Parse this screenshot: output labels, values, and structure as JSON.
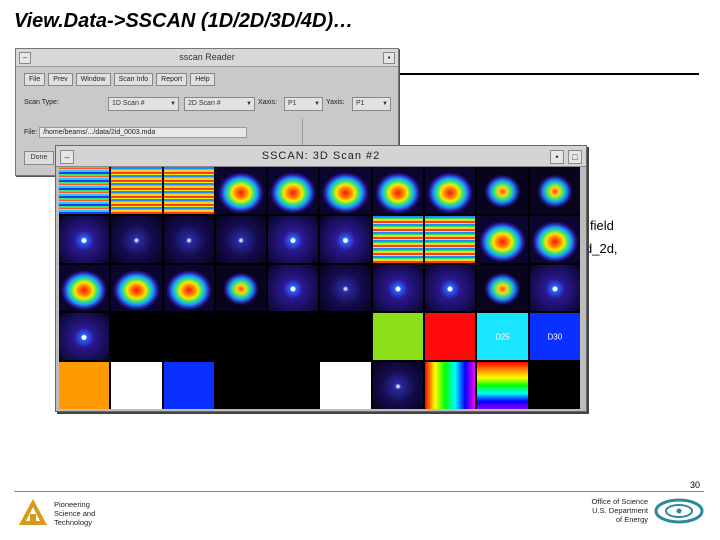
{
  "slide": {
    "title": "View.Data->SSCAN (1D/2D/3D/4D)…",
    "bg_text_1": "field",
    "bg_text_2": "d_2d,",
    "page_number": "30"
  },
  "reader_window": {
    "title": "sscan Reader",
    "menu": [
      "File",
      "Prev",
      "Window",
      "Scan Info",
      "Report",
      "Help"
    ],
    "scan_type_label": "Scan Type:",
    "combo_1": "1D Scan #",
    "combo_2": "2D Scan #",
    "xaxis_label": "Xaxis:",
    "xaxis_value": "P1",
    "yaxis_label": "Yaxis:",
    "yaxis_value": "P1",
    "file_label": "File:",
    "file_value": "/home/beams/.../data/2id_0003.mda",
    "button": "Done"
  },
  "scan_window": {
    "title": "SSCAN: 3D Scan #2",
    "cell_labels": {
      "38": "D25",
      "39": "D30"
    },
    "cells": [
      "stripes-cool",
      "stripes-warm",
      "stripes-warm",
      "blob-big",
      "blob-big",
      "blob-big",
      "blob-big",
      "blob-big",
      "blob-med",
      "blob-med",
      "dot",
      "dot-fade",
      "dot-fade",
      "dot-fade",
      "dot",
      "dot",
      "stripes-warm",
      "stripes-warm",
      "blob-big",
      "blob-big",
      "blob-big",
      "blob-big",
      "blob-big",
      "blob-med",
      "dot",
      "dot-fade",
      "dot",
      "dot",
      "blob-med",
      "dot",
      "dot",
      "black",
      "black",
      "black",
      "black",
      "black",
      "green",
      "red",
      "cyan",
      "blue",
      "orange",
      "white",
      "blue",
      "black",
      "black",
      "white",
      "dot-fade",
      "rainbow-h",
      "rainbow-v",
      "black"
    ]
  },
  "footer": {
    "left_lines": [
      "Pioneering",
      "Science and",
      "Technology"
    ],
    "right_lines": [
      "Office of Science",
      "U.S. Department",
      "of Energy"
    ]
  },
  "colors": {
    "accent_gold": "#d89a1a",
    "doe_teal": "#2a8a9a"
  },
  "icons": {
    "close": "close-icon",
    "menu": "window-menu-icon",
    "minimize": "minimize-icon",
    "maximize": "maximize-icon",
    "dropdown": "chevron-down-icon"
  }
}
